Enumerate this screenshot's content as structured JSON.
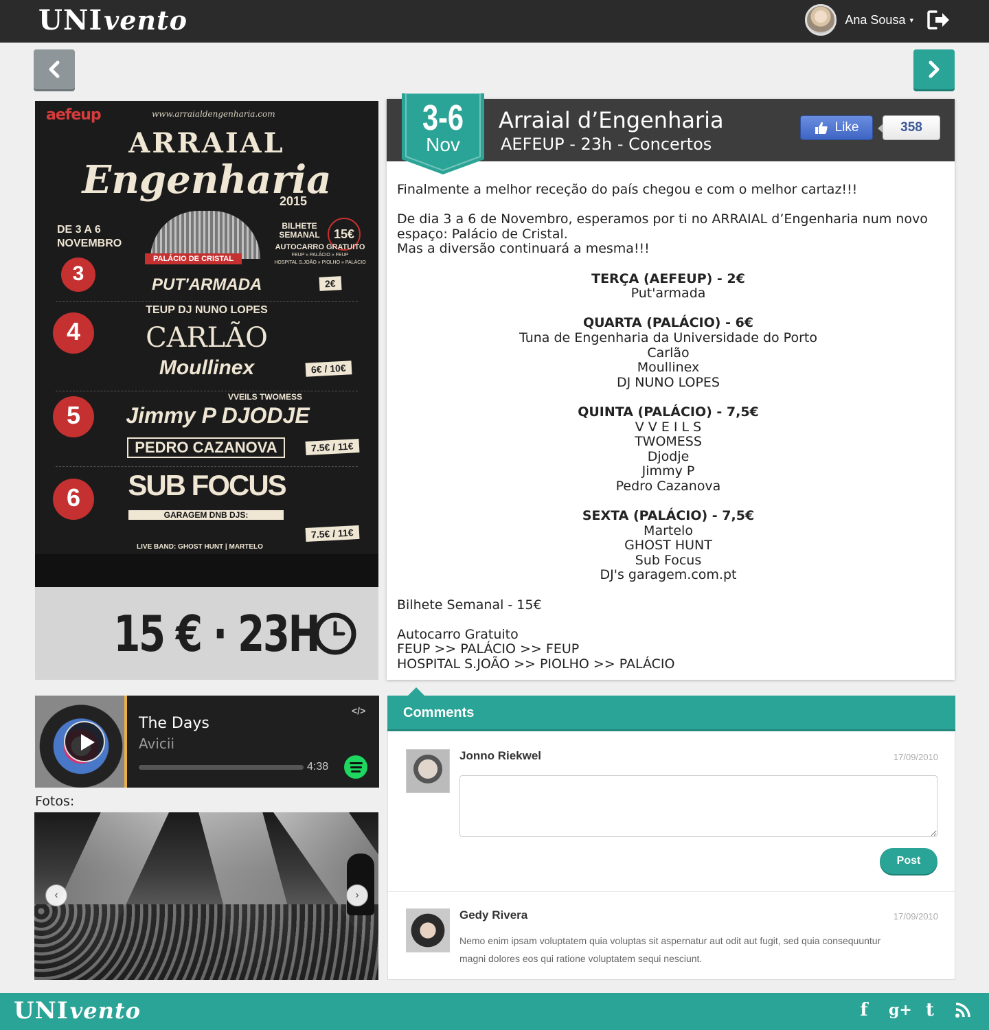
{
  "app": {
    "logo_main": "UNI",
    "logo_script": "vento"
  },
  "user": {
    "name": "Ana Sousa",
    "caret": "▾"
  },
  "nav": {
    "prev_icon": "chevron-left-icon",
    "next_icon": "chevron-right-icon"
  },
  "poster": {
    "site": "www.arraialdengenharia.com",
    "org": "aefeup",
    "title_line1": "ARRAIAL",
    "title_line2": "Engenharia",
    "year": "2015",
    "dates": "DE 3 A 6 NOVEMBRO",
    "venue": "PALÁCIO DE CRISTAL",
    "ticket_label": "BILHETE SEMANAL",
    "ticket_price": "15€",
    "bus_title": "AUTOCARRO GRATUITO",
    "bus_route1": "FEUP » PALÁCIO » FEUP",
    "bus_route2": "HOSPITAL S.JOÃO » PIOLHO » PALÁCIO",
    "days": [
      {
        "num": "3",
        "act": "PUT'ARMADA",
        "price": "2€"
      },
      {
        "num": "4",
        "act": "CARLÃO",
        "extra": "TEUP  DJ NUNO LOPES",
        "act2": "Moullinex",
        "price": "6€ / 10€"
      },
      {
        "num": "5",
        "act": "Jimmy P  DJODJE",
        "extra": "VVEILS  TWOMESS",
        "act2": "PEDRO CAZANOVA",
        "price": "7.5€ / 11€"
      },
      {
        "num": "6",
        "act": "SUB FOCUS",
        "extra": "GARAGEM DNB DJS:",
        "act2": "LIVE BAND: GHOST HUNT | MARTELO",
        "price": "7.5€ / 11€"
      }
    ]
  },
  "price_panel": {
    "text": "15 € · 23H",
    "icon": "clock-icon"
  },
  "event": {
    "days": "3-6",
    "month": "Nov",
    "title": "Arraial d’Engenharia",
    "subtitle": "AEFEUP - 23h - Concertos",
    "like_label": "Like",
    "like_count": "358",
    "intro": "Finalmente a melhor receção do país chegou e com o melhor cartaz!!!",
    "para2_line1": "De dia 3 a 6 de Novembro, esperamos por ti no ARRAIAL d’Engenharia num novo espaço: Palácio de Cristal.",
    "para2_line2": "Mas a diversão continuará a mesma!!!",
    "lineup": [
      {
        "day": "TERÇA (AEFEUP) - 2€",
        "acts": [
          "Put'armada"
        ]
      },
      {
        "day": "QUARTA (PALÁCIO) - 6€",
        "acts": [
          "Tuna de Engenharia da Universidade do Porto",
          "Carlão",
          "Moullinex",
          "DJ NUNO LOPES"
        ]
      },
      {
        "day": "QUINTA (PALÁCIO) - 7,5€",
        "acts": [
          "V V E I L S",
          "TWOMESS",
          "Djodje",
          "Jimmy P",
          "Pedro Cazanova"
        ]
      },
      {
        "day": "SEXTA (PALÁCIO) - 7,5€",
        "acts": [
          "Martelo",
          "GHOST HUNT",
          "Sub Focus",
          "DJ's garagem.com.pt"
        ]
      }
    ],
    "ticket": "Bilhete Semanal - 15€",
    "bus_title": "Autocarro Gratuito",
    "bus_route1": "FEUP >> PALÁCIO >> FEUP",
    "bus_route2": "HOSPITAL S.JOÃO >> PIOLHO >> PALÁCIO"
  },
  "player": {
    "title": "The Days",
    "artist": "Avicii",
    "duration": "4:38",
    "embed": "</>"
  },
  "photos": {
    "label": "Fotos:",
    "prev": "‹",
    "next": "›"
  },
  "comments": {
    "title": "Comments",
    "items": [
      {
        "name": "Jonno Riekwel",
        "date": "17/09/2010",
        "post_label": "Post"
      },
      {
        "name": "Gedy Rivera",
        "date": "17/09/2010",
        "text": "Nemo enim ipsam voluptatem quia voluptas sit aspernatur aut odit aut fugit, sed quia consequuntur magni dolores eos qui ratione voluptatem sequi nesciunt."
      }
    ]
  },
  "footer": {
    "logo_main": "UNI",
    "logo_script": "vento",
    "socials": [
      "f",
      "g+",
      "t",
      "rss"
    ]
  },
  "colors": {
    "topbar": "#2b2b2b",
    "accent": "#2aa496",
    "facebook": "#3b5998"
  }
}
